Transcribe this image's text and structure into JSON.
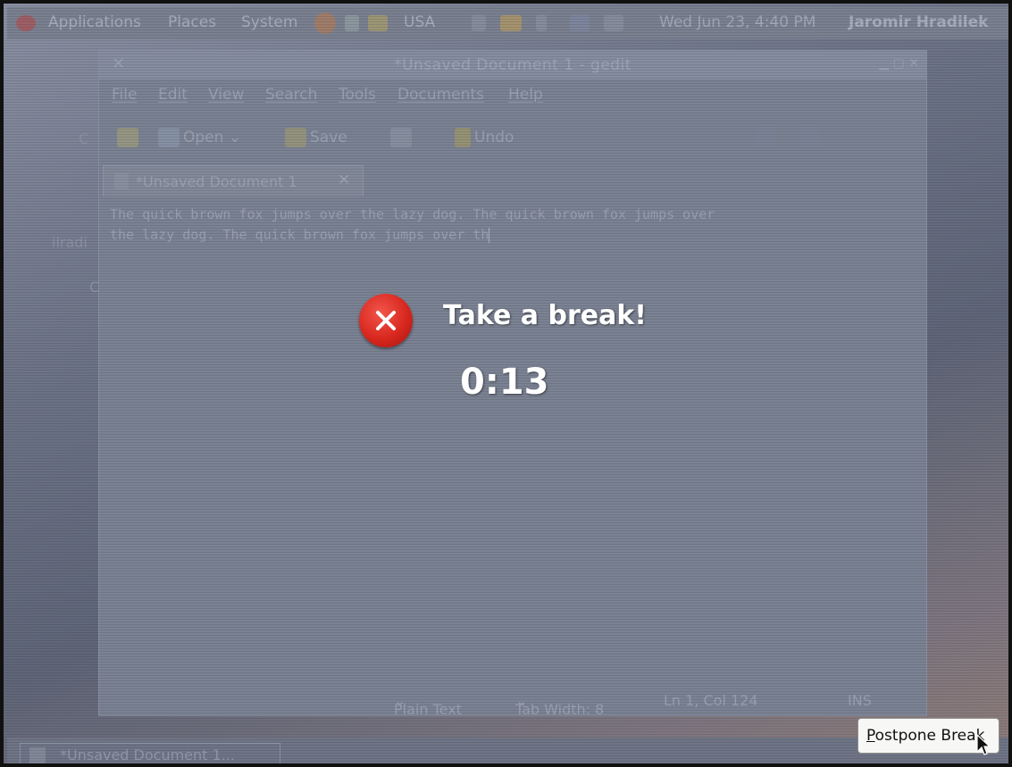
{
  "top_panel": {
    "applications": "Applications",
    "places": "Places",
    "system": "System",
    "keyboard_layout": "USA",
    "clock": "Wed Jun 23,  4:40 PM",
    "user": "Jaromir Hradilek"
  },
  "gedit": {
    "window_title": "*Unsaved Document 1 - gedit",
    "menu": [
      "File",
      "Edit",
      "View",
      "Search",
      "Tools",
      "Documents",
      "Help"
    ],
    "toolbar": {
      "open": "Open",
      "save": "Save",
      "undo": "Undo"
    },
    "tab_label": "*Unsaved Document 1",
    "text_lines": [
      "The quick brown fox jumps over the lazy dog. The quick brown fox jumps over",
      "the lazy dog. The quick brown fox jumps over th"
    ],
    "status": {
      "language": "Plain Text",
      "tab_width": "Tab Width:  8",
      "position": "Ln 1, Col 124",
      "mode": "INS"
    }
  },
  "background_fragments": {
    "left1": "C",
    "left2": "ilradi",
    "left3": "C"
  },
  "bottom_panel": {
    "task_button": "*Unsaved Document 1..."
  },
  "break_dialog": {
    "title": "Take a break!",
    "timer": "0:13",
    "postpone_button": "Postpone Break"
  },
  "colors": {
    "accent_red": "#d8281f",
    "overlay": "#6d7486"
  }
}
